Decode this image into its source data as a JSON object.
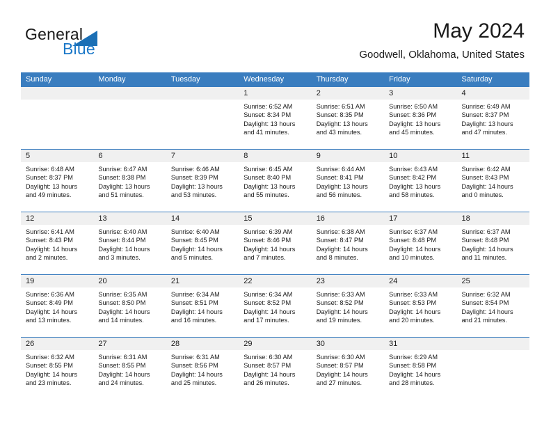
{
  "brand": {
    "word_one": "General",
    "word_two": "Blue",
    "triangle_color": "#1b6fb5",
    "blue_color": "#1b78c8"
  },
  "header": {
    "month_title": "May 2024",
    "location": "Goodwell, Oklahoma, United States"
  },
  "theme": {
    "header_blue": "#3a7dbf",
    "band_gray": "#f0f0f0",
    "text_color": "#1a1a1a"
  },
  "weekdays": [
    "Sunday",
    "Monday",
    "Tuesday",
    "Wednesday",
    "Thursday",
    "Friday",
    "Saturday"
  ],
  "weeks": [
    [
      {
        "day": "",
        "sunrise": "",
        "sunset": "",
        "daylight_line1": "",
        "daylight_line2": ""
      },
      {
        "day": "",
        "sunrise": "",
        "sunset": "",
        "daylight_line1": "",
        "daylight_line2": ""
      },
      {
        "day": "",
        "sunrise": "",
        "sunset": "",
        "daylight_line1": "",
        "daylight_line2": ""
      },
      {
        "day": "1",
        "sunrise": "Sunrise: 6:52 AM",
        "sunset": "Sunset: 8:34 PM",
        "daylight_line1": "Daylight: 13 hours",
        "daylight_line2": "and 41 minutes."
      },
      {
        "day": "2",
        "sunrise": "Sunrise: 6:51 AM",
        "sunset": "Sunset: 8:35 PM",
        "daylight_line1": "Daylight: 13 hours",
        "daylight_line2": "and 43 minutes."
      },
      {
        "day": "3",
        "sunrise": "Sunrise: 6:50 AM",
        "sunset": "Sunset: 8:36 PM",
        "daylight_line1": "Daylight: 13 hours",
        "daylight_line2": "and 45 minutes."
      },
      {
        "day": "4",
        "sunrise": "Sunrise: 6:49 AM",
        "sunset": "Sunset: 8:37 PM",
        "daylight_line1": "Daylight: 13 hours",
        "daylight_line2": "and 47 minutes."
      }
    ],
    [
      {
        "day": "5",
        "sunrise": "Sunrise: 6:48 AM",
        "sunset": "Sunset: 8:37 PM",
        "daylight_line1": "Daylight: 13 hours",
        "daylight_line2": "and 49 minutes."
      },
      {
        "day": "6",
        "sunrise": "Sunrise: 6:47 AM",
        "sunset": "Sunset: 8:38 PM",
        "daylight_line1": "Daylight: 13 hours",
        "daylight_line2": "and 51 minutes."
      },
      {
        "day": "7",
        "sunrise": "Sunrise: 6:46 AM",
        "sunset": "Sunset: 8:39 PM",
        "daylight_line1": "Daylight: 13 hours",
        "daylight_line2": "and 53 minutes."
      },
      {
        "day": "8",
        "sunrise": "Sunrise: 6:45 AM",
        "sunset": "Sunset: 8:40 PM",
        "daylight_line1": "Daylight: 13 hours",
        "daylight_line2": "and 55 minutes."
      },
      {
        "day": "9",
        "sunrise": "Sunrise: 6:44 AM",
        "sunset": "Sunset: 8:41 PM",
        "daylight_line1": "Daylight: 13 hours",
        "daylight_line2": "and 56 minutes."
      },
      {
        "day": "10",
        "sunrise": "Sunrise: 6:43 AM",
        "sunset": "Sunset: 8:42 PM",
        "daylight_line1": "Daylight: 13 hours",
        "daylight_line2": "and 58 minutes."
      },
      {
        "day": "11",
        "sunrise": "Sunrise: 6:42 AM",
        "sunset": "Sunset: 8:43 PM",
        "daylight_line1": "Daylight: 14 hours",
        "daylight_line2": "and 0 minutes."
      }
    ],
    [
      {
        "day": "12",
        "sunrise": "Sunrise: 6:41 AM",
        "sunset": "Sunset: 8:43 PM",
        "daylight_line1": "Daylight: 14 hours",
        "daylight_line2": "and 2 minutes."
      },
      {
        "day": "13",
        "sunrise": "Sunrise: 6:40 AM",
        "sunset": "Sunset: 8:44 PM",
        "daylight_line1": "Daylight: 14 hours",
        "daylight_line2": "and 3 minutes."
      },
      {
        "day": "14",
        "sunrise": "Sunrise: 6:40 AM",
        "sunset": "Sunset: 8:45 PM",
        "daylight_line1": "Daylight: 14 hours",
        "daylight_line2": "and 5 minutes."
      },
      {
        "day": "15",
        "sunrise": "Sunrise: 6:39 AM",
        "sunset": "Sunset: 8:46 PM",
        "daylight_line1": "Daylight: 14 hours",
        "daylight_line2": "and 7 minutes."
      },
      {
        "day": "16",
        "sunrise": "Sunrise: 6:38 AM",
        "sunset": "Sunset: 8:47 PM",
        "daylight_line1": "Daylight: 14 hours",
        "daylight_line2": "and 8 minutes."
      },
      {
        "day": "17",
        "sunrise": "Sunrise: 6:37 AM",
        "sunset": "Sunset: 8:48 PM",
        "daylight_line1": "Daylight: 14 hours",
        "daylight_line2": "and 10 minutes."
      },
      {
        "day": "18",
        "sunrise": "Sunrise: 6:37 AM",
        "sunset": "Sunset: 8:48 PM",
        "daylight_line1": "Daylight: 14 hours",
        "daylight_line2": "and 11 minutes."
      }
    ],
    [
      {
        "day": "19",
        "sunrise": "Sunrise: 6:36 AM",
        "sunset": "Sunset: 8:49 PM",
        "daylight_line1": "Daylight: 14 hours",
        "daylight_line2": "and 13 minutes."
      },
      {
        "day": "20",
        "sunrise": "Sunrise: 6:35 AM",
        "sunset": "Sunset: 8:50 PM",
        "daylight_line1": "Daylight: 14 hours",
        "daylight_line2": "and 14 minutes."
      },
      {
        "day": "21",
        "sunrise": "Sunrise: 6:34 AM",
        "sunset": "Sunset: 8:51 PM",
        "daylight_line1": "Daylight: 14 hours",
        "daylight_line2": "and 16 minutes."
      },
      {
        "day": "22",
        "sunrise": "Sunrise: 6:34 AM",
        "sunset": "Sunset: 8:52 PM",
        "daylight_line1": "Daylight: 14 hours",
        "daylight_line2": "and 17 minutes."
      },
      {
        "day": "23",
        "sunrise": "Sunrise: 6:33 AM",
        "sunset": "Sunset: 8:52 PM",
        "daylight_line1": "Daylight: 14 hours",
        "daylight_line2": "and 19 minutes."
      },
      {
        "day": "24",
        "sunrise": "Sunrise: 6:33 AM",
        "sunset": "Sunset: 8:53 PM",
        "daylight_line1": "Daylight: 14 hours",
        "daylight_line2": "and 20 minutes."
      },
      {
        "day": "25",
        "sunrise": "Sunrise: 6:32 AM",
        "sunset": "Sunset: 8:54 PM",
        "daylight_line1": "Daylight: 14 hours",
        "daylight_line2": "and 21 minutes."
      }
    ],
    [
      {
        "day": "26",
        "sunrise": "Sunrise: 6:32 AM",
        "sunset": "Sunset: 8:55 PM",
        "daylight_line1": "Daylight: 14 hours",
        "daylight_line2": "and 23 minutes."
      },
      {
        "day": "27",
        "sunrise": "Sunrise: 6:31 AM",
        "sunset": "Sunset: 8:55 PM",
        "daylight_line1": "Daylight: 14 hours",
        "daylight_line2": "and 24 minutes."
      },
      {
        "day": "28",
        "sunrise": "Sunrise: 6:31 AM",
        "sunset": "Sunset: 8:56 PM",
        "daylight_line1": "Daylight: 14 hours",
        "daylight_line2": "and 25 minutes."
      },
      {
        "day": "29",
        "sunrise": "Sunrise: 6:30 AM",
        "sunset": "Sunset: 8:57 PM",
        "daylight_line1": "Daylight: 14 hours",
        "daylight_line2": "and 26 minutes."
      },
      {
        "day": "30",
        "sunrise": "Sunrise: 6:30 AM",
        "sunset": "Sunset: 8:57 PM",
        "daylight_line1": "Daylight: 14 hours",
        "daylight_line2": "and 27 minutes."
      },
      {
        "day": "31",
        "sunrise": "Sunrise: 6:29 AM",
        "sunset": "Sunset: 8:58 PM",
        "daylight_line1": "Daylight: 14 hours",
        "daylight_line2": "and 28 minutes."
      },
      {
        "day": "",
        "sunrise": "",
        "sunset": "",
        "daylight_line1": "",
        "daylight_line2": ""
      }
    ]
  ]
}
